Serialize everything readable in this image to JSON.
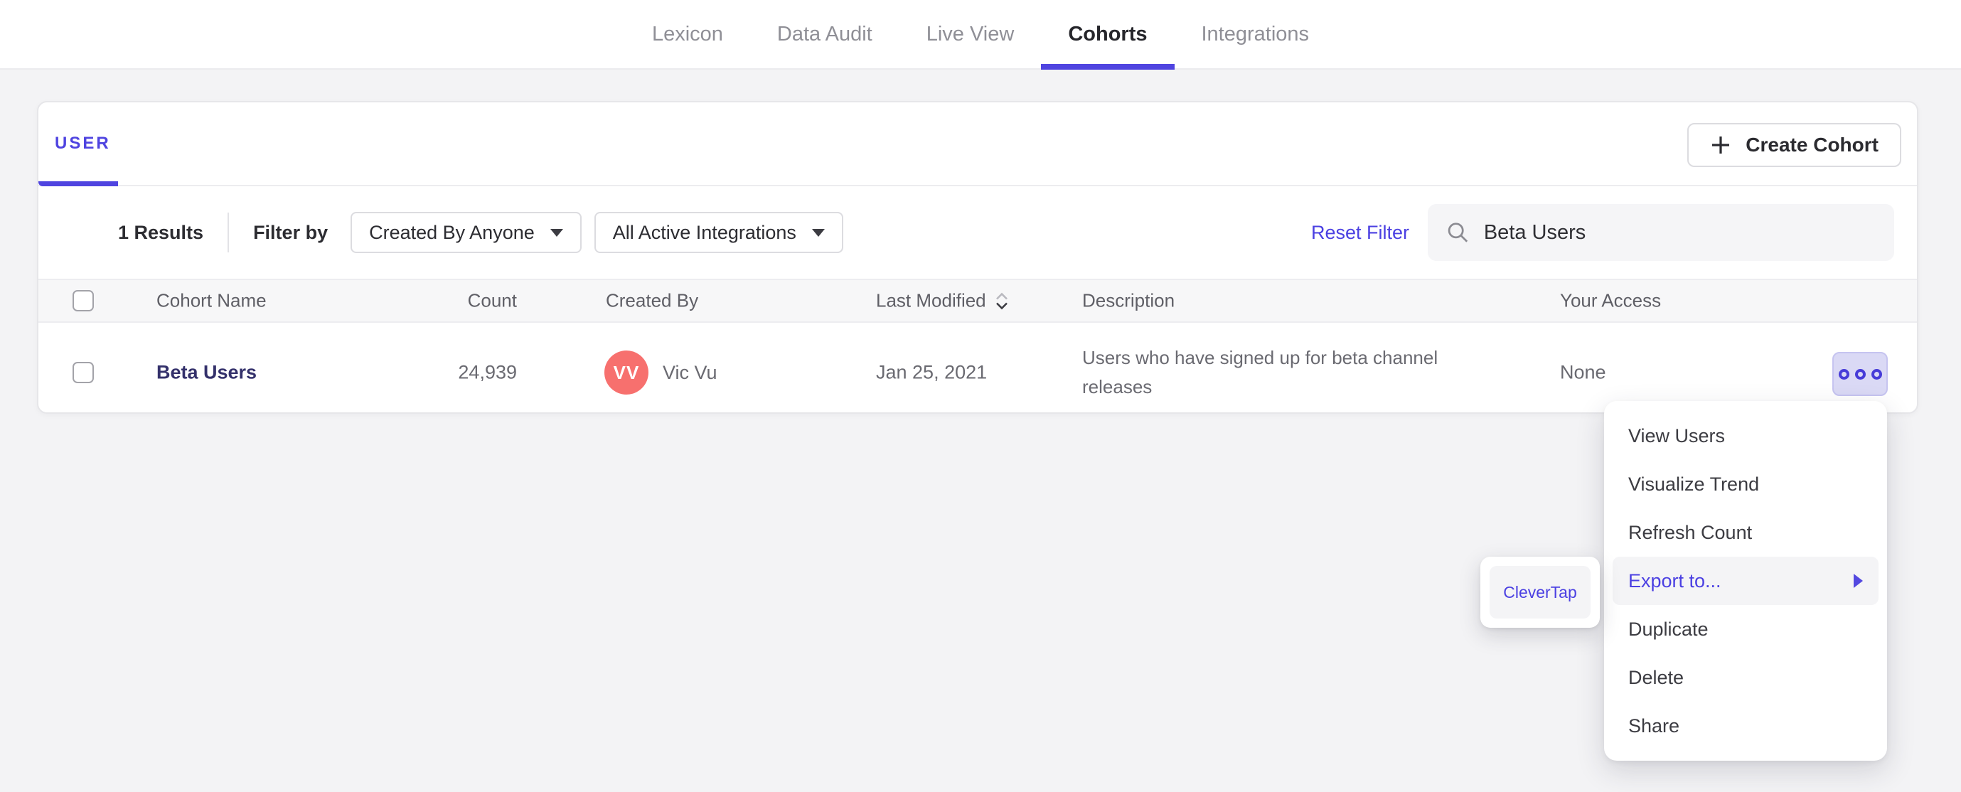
{
  "colors": {
    "accent": "#4f44e0",
    "link": "#4b40e2",
    "avatar_red": "#f7706e",
    "cohort_link": "#34316b",
    "more_button_bg": "#dad9f5",
    "menu_highlight_bg": "#f4f4f6",
    "page_bg": "#f3f3f5"
  },
  "nav": {
    "active_tab": "Cohorts",
    "tabs": [
      {
        "label": "Lexicon"
      },
      {
        "label": "Data Audit"
      },
      {
        "label": "Live View"
      },
      {
        "label": "Cohorts"
      },
      {
        "label": "Integrations"
      }
    ]
  },
  "cohorts_panel": {
    "tab_label": "USER",
    "create_cohort_label": "Create Cohort",
    "filter_bar": {
      "results_text": "1 Results",
      "filter_by_label": "Filter by",
      "created_by_dropdown": {
        "value": "Created By Anyone"
      },
      "integrations_dropdown": {
        "value": "All Active Integrations"
      },
      "reset_filter_label": "Reset Filter",
      "search_input": {
        "value": "Beta Users"
      }
    },
    "table": {
      "columns": {
        "name": "Cohort Name",
        "count": "Count",
        "created_by": "Created By",
        "last_modified": "Last Modified",
        "description": "Description",
        "access": "Your Access"
      },
      "rows": [
        {
          "name": "Beta Users",
          "count": "24,939",
          "avatar_initials": "VV",
          "created_by": "Vic Vu",
          "last_modified": "Jan 25, 2021",
          "description": "Users who have signed up for beta channel releases",
          "access": "None"
        }
      ]
    }
  },
  "row_actions_menu": {
    "highlighted_item": "Export to...",
    "items": [
      {
        "label": "View Users"
      },
      {
        "label": "Visualize Trend"
      },
      {
        "label": "Refresh Count"
      },
      {
        "label": "Export to..."
      },
      {
        "label": "Duplicate"
      },
      {
        "label": "Delete"
      },
      {
        "label": "Share"
      }
    ],
    "submenu": {
      "items": [
        {
          "label": "CleverTap"
        }
      ]
    }
  }
}
